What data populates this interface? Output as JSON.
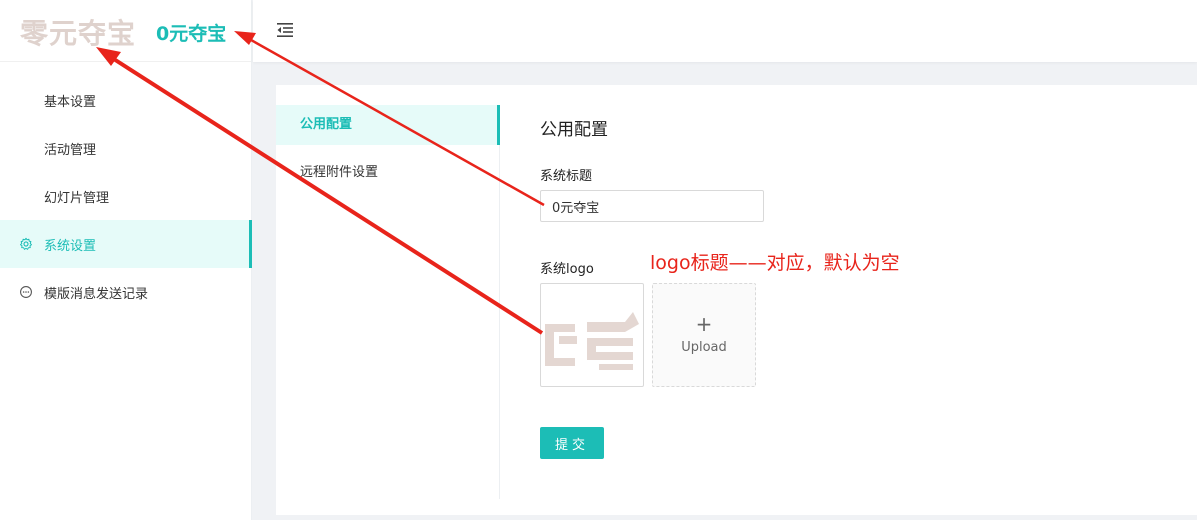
{
  "brand": {
    "logo_text": "零元夺宝",
    "title": "0元夺宝"
  },
  "header": {
    "fold_icon": "menu-fold-icon"
  },
  "sidebar": {
    "items": [
      {
        "label": "基本设置",
        "icon": ""
      },
      {
        "label": "活动管理",
        "icon": ""
      },
      {
        "label": "幻灯片管理",
        "icon": ""
      },
      {
        "label": "系统设置",
        "icon": "gear-icon",
        "active": true
      },
      {
        "label": "模版消息发送记录",
        "icon": "chat-bubble-icon"
      }
    ]
  },
  "subnav": {
    "items": [
      {
        "label": "公用配置",
        "active": true
      },
      {
        "label": "远程附件设置",
        "active": false
      }
    ]
  },
  "form": {
    "heading": "公用配置",
    "title_label": "系统标题",
    "title_value": "0元夺宝",
    "logo_label": "系统logo",
    "upload_plus": "+",
    "upload_label": "Upload",
    "submit_label": "提交"
  },
  "annotation": {
    "text": "logo标题——对应，默认为空"
  },
  "colors": {
    "accent": "#1cbdb6",
    "annotation_red": "#e8241b",
    "logo_tint": "#dfd2cd"
  }
}
